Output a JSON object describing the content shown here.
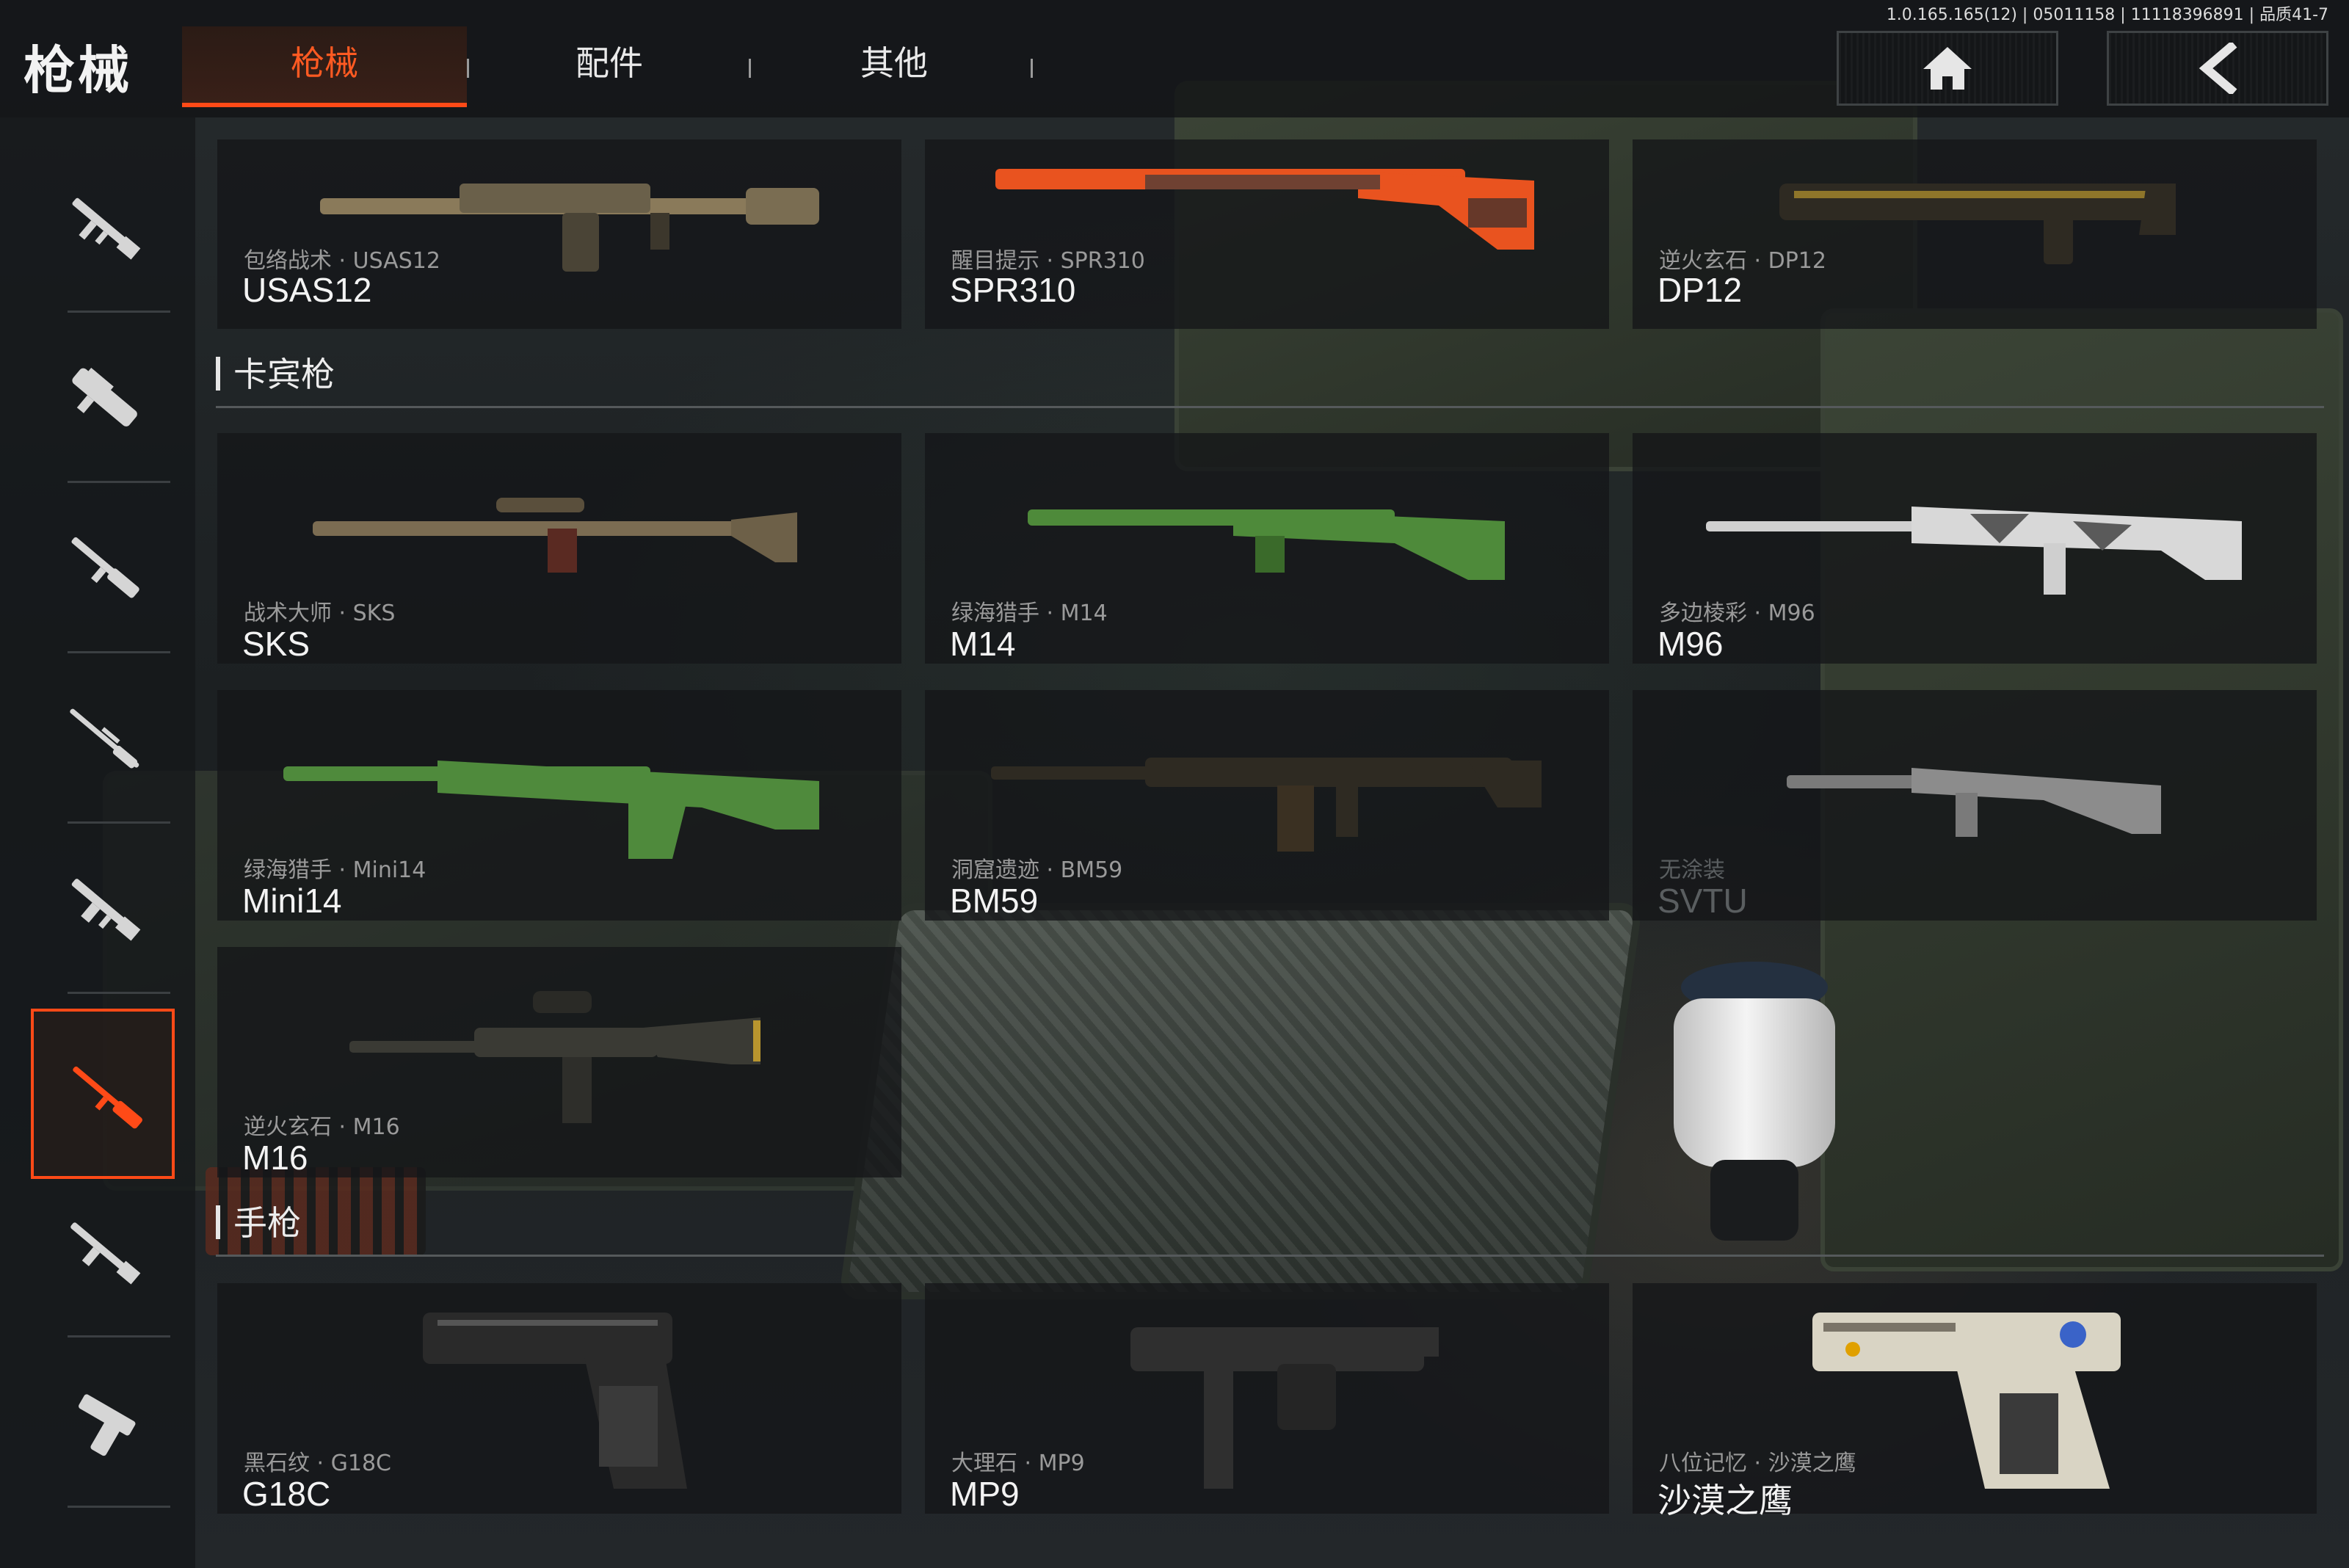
{
  "header": {
    "title": "枪械",
    "version": "1.0.165.165(12) | 05011158 | 11118396891 | 品质41-7",
    "tabs": [
      {
        "label": "枪械",
        "active": true
      },
      {
        "label": "配件",
        "active": false
      },
      {
        "label": "其他",
        "active": false
      }
    ],
    "home_icon": "home-icon",
    "back_icon": "back-arrow-icon",
    "accent_color": "#ff4a17"
  },
  "sidebar": {
    "items": [
      {
        "icon": "assault-rifle-icon",
        "active": false
      },
      {
        "icon": "smg-icon",
        "active": false
      },
      {
        "icon": "shotgun-icon",
        "active": false
      },
      {
        "icon": "sniper-rifle-icon",
        "active": false
      },
      {
        "icon": "machine-gun-icon",
        "active": false
      },
      {
        "icon": "carbine-icon",
        "active": true
      },
      {
        "icon": "rifle-icon",
        "active": false
      },
      {
        "icon": "pistol-icon",
        "active": false
      }
    ]
  },
  "sections": [
    {
      "label": "",
      "cards": [
        {
          "skin": "包络战术 · USAS12",
          "name": "USAS12",
          "color": "#8a7a5a"
        },
        {
          "skin": "醒目提示 · SPR310",
          "name": "SPR310",
          "color": "#e9531f"
        },
        {
          "skin": "逆火玄石 · DP12",
          "name": "DP12",
          "color": "#3a3226"
        }
      ]
    },
    {
      "label": "卡宾枪",
      "cards": [
        {
          "skin": "战术大师 · SKS",
          "name": "SKS",
          "color": "#7b6c52"
        },
        {
          "skin": "绿海猎手 · M14",
          "name": "M14",
          "color": "#4e8a3a"
        },
        {
          "skin": "多边棱彩 · M96",
          "name": "M96",
          "color": "#d8d8d8"
        },
        {
          "skin": "绿海猎手 · Mini14",
          "name": "Mini14",
          "color": "#4f8a3c"
        },
        {
          "skin": "洞窟遗迹 · BM59",
          "name": "BM59",
          "color": "#2e2a22"
        },
        {
          "skin": "无涂装",
          "name": "SVTU",
          "color": "#8c8c8c",
          "locked": true
        },
        {
          "skin": "逆火玄石 · M16",
          "name": "M16",
          "color": "#3a3a34"
        }
      ]
    },
    {
      "label": "手枪",
      "cards": [
        {
          "skin": "黑石纹 · G18C",
          "name": "G18C",
          "color": "#2a2a2a"
        },
        {
          "skin": "大理石 · MP9",
          "name": "MP9",
          "color": "#2f2f2f"
        },
        {
          "skin": "八位记忆 · 沙漠之鹰",
          "name": "沙漠之鹰",
          "color": "#d9d4c4"
        }
      ]
    }
  ]
}
